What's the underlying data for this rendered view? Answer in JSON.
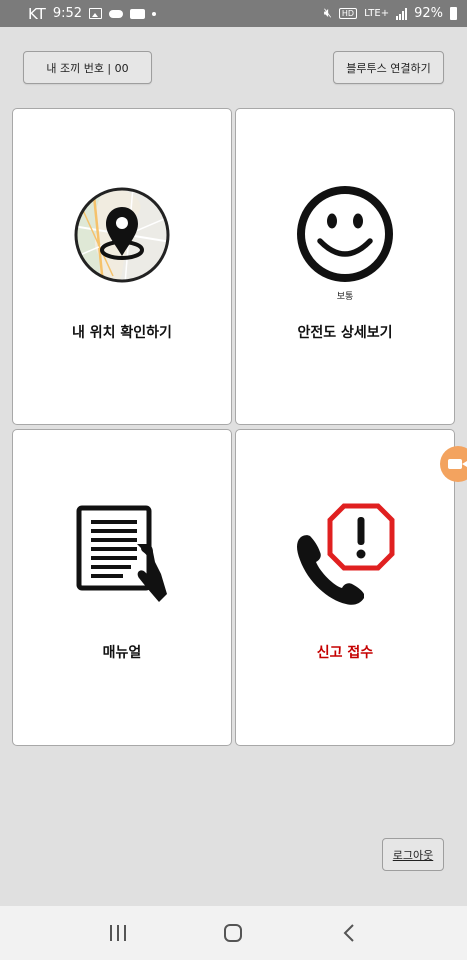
{
  "status_bar": {
    "carrier": "KT",
    "time": "9:52",
    "network": "LTE+",
    "battery": "92%"
  },
  "top": {
    "device_number_label": "내 조끼 번호  |  00",
    "bluetooth_label": "블루투스 연결하기"
  },
  "cards": {
    "location": {
      "label": "내 위치 확인하기",
      "icon": "map-pin-icon"
    },
    "safety": {
      "label": "안전도 상세보기",
      "status": "보통",
      "icon": "smiley-face-icon"
    },
    "manual": {
      "label": "매뉴얼",
      "icon": "document-hand-icon"
    },
    "report": {
      "label": "신고 접수",
      "icon": "phone-alert-icon",
      "color": "#c50000"
    }
  },
  "logout_label": "로그아웃",
  "colors": {
    "background": "#e0e0e0",
    "status_bar": "#7b7b7b",
    "alert_red": "#e02020",
    "report_text": "#c50000",
    "floating_button": "#f3a35f"
  }
}
